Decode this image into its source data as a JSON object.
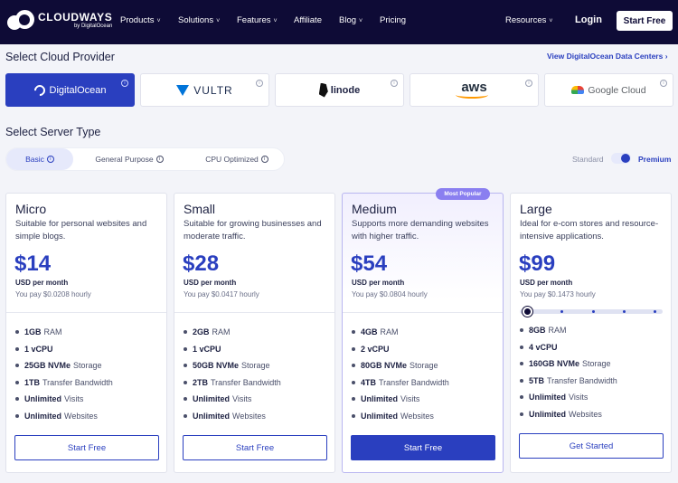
{
  "nav": {
    "brand": "CLOUDWAYS",
    "brand_sub": "by DigitalOcean",
    "items": [
      "Products",
      "Solutions",
      "Features",
      "Affiliate",
      "Blog",
      "Pricing"
    ],
    "resources": "Resources",
    "login": "Login",
    "start_free": "Start Free"
  },
  "providers": {
    "title": "Select Cloud Provider",
    "view_link": "View DigitalOcean Data Centers",
    "items": [
      "DigitalOcean",
      "VULTR",
      "linode",
      "aws",
      "Google Cloud"
    ],
    "selected": "DigitalOcean"
  },
  "server_type": {
    "title": "Select Server Type",
    "tabs": [
      "Basic",
      "General Purpose",
      "CPU Optimized"
    ],
    "selected_tab": "Basic",
    "toggle_left": "Standard",
    "toggle_right": "Premium",
    "toggle_value": "Premium"
  },
  "plans": [
    {
      "name": "Micro",
      "desc": "Suitable for personal websites and simple blogs.",
      "price": "$14",
      "per_month": "USD per month",
      "hourly": "You pay $0.0208 hourly",
      "features": [
        {
          "v": "1GB",
          "t": "RAM"
        },
        {
          "v": "1 vCPU",
          "t": ""
        },
        {
          "v": "25GB NVMe",
          "t": "Storage"
        },
        {
          "v": "1TB",
          "t": "Transfer Bandwidth"
        },
        {
          "v": "Unlimited",
          "t": "Visits"
        },
        {
          "v": "Unlimited",
          "t": "Websites"
        }
      ],
      "button": "Start Free"
    },
    {
      "name": "Small",
      "desc": "Suitable for growing businesses and moderate traffic.",
      "price": "$28",
      "per_month": "USD per month",
      "hourly": "You pay $0.0417 hourly",
      "features": [
        {
          "v": "2GB",
          "t": "RAM"
        },
        {
          "v": "1 vCPU",
          "t": ""
        },
        {
          "v": "50GB NVMe",
          "t": "Storage"
        },
        {
          "v": "2TB",
          "t": "Transfer Bandwidth"
        },
        {
          "v": "Unlimited",
          "t": "Visits"
        },
        {
          "v": "Unlimited",
          "t": "Websites"
        }
      ],
      "button": "Start Free"
    },
    {
      "name": "Medium",
      "badge": "Most Popular",
      "desc": "Supports more demanding websites with higher traffic.",
      "price": "$54",
      "per_month": "USD per month",
      "hourly": "You pay $0.0804 hourly",
      "features": [
        {
          "v": "4GB",
          "t": "RAM"
        },
        {
          "v": "2 vCPU",
          "t": ""
        },
        {
          "v": "80GB NVMe",
          "t": "Storage"
        },
        {
          "v": "4TB",
          "t": "Transfer Bandwidth"
        },
        {
          "v": "Unlimited",
          "t": "Visits"
        },
        {
          "v": "Unlimited",
          "t": "Websites"
        }
      ],
      "button": "Start Free"
    },
    {
      "name": "Large",
      "desc": "Ideal for e-com stores and resource-intensive applications.",
      "price": "$99",
      "per_month": "USD per month",
      "hourly": "You pay $0.1473 hourly",
      "slider_position": 0,
      "slider_steps": 5,
      "features": [
        {
          "v": "8GB",
          "t": "RAM"
        },
        {
          "v": "4 vCPU",
          "t": ""
        },
        {
          "v": "160GB NVMe",
          "t": "Storage"
        },
        {
          "v": "5TB",
          "t": "Transfer Bandwidth"
        },
        {
          "v": "Unlimited",
          "t": "Visits"
        },
        {
          "v": "Unlimited",
          "t": "Websites"
        }
      ],
      "button": "Get Started"
    }
  ],
  "colors": {
    "nav_bg": "#0e0b36",
    "accent": "#2a3fbf",
    "badge": "#8a7ff0"
  }
}
